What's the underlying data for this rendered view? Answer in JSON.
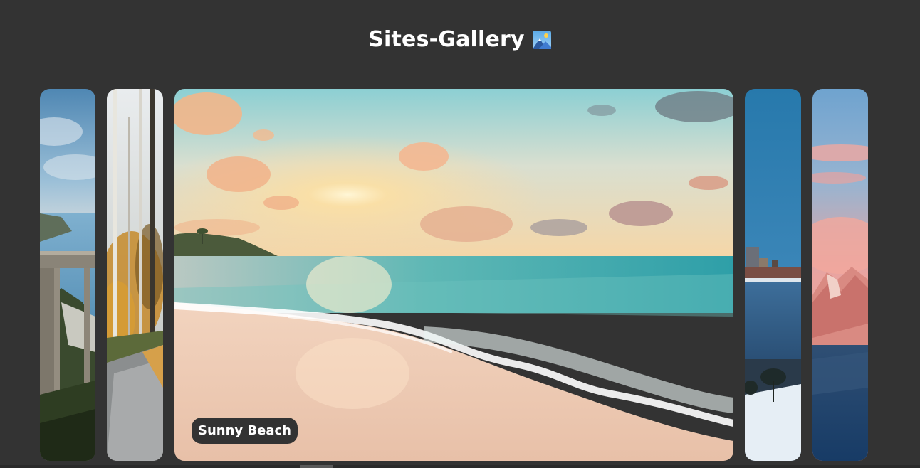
{
  "header": {
    "title": "Sites-Gallery",
    "icon": "landscape-picture-icon"
  },
  "gallery": {
    "active_caption": "Sunny Beach",
    "panels": [
      {
        "scene": "coastal-bridge-image",
        "active": false
      },
      {
        "scene": "autumn-forest-path-image",
        "active": false
      },
      {
        "scene": "sunny-beach-image",
        "active": true
      },
      {
        "scene": "winter-city-lake-image",
        "active": false
      },
      {
        "scene": "pink-mountain-image",
        "active": false
      }
    ]
  },
  "colors": {
    "background": "#333333",
    "caption_background": "#333333",
    "text": "#ffffff"
  }
}
